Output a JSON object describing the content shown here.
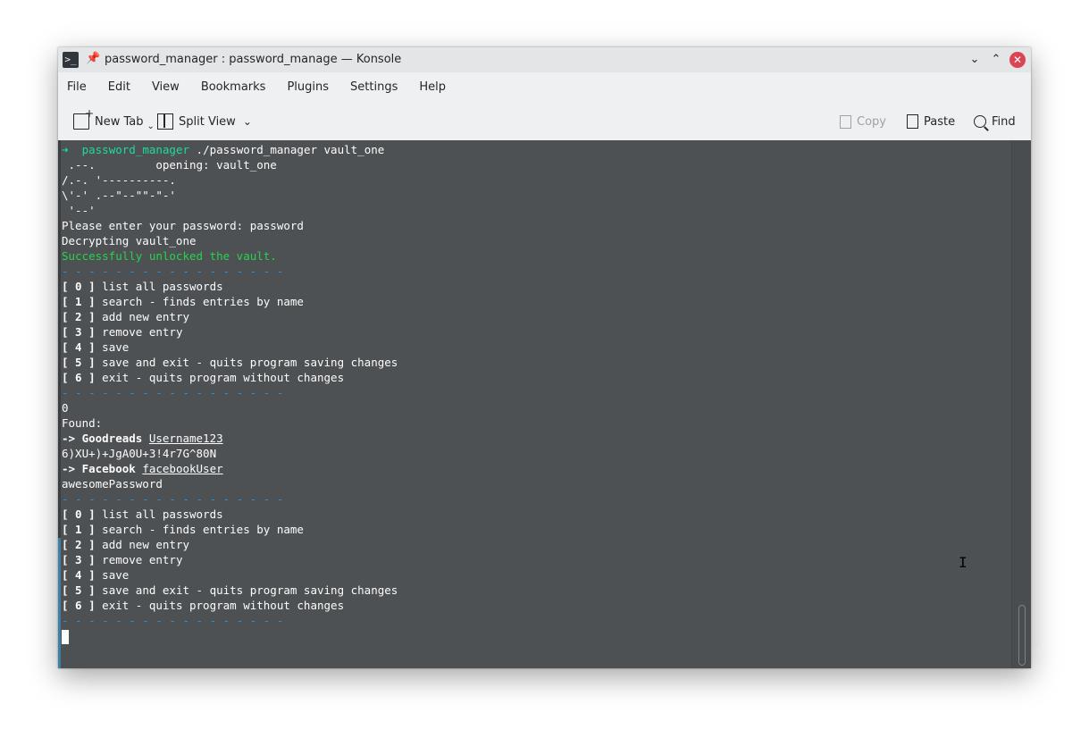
{
  "window": {
    "title": "password_manager : password_manage — Konsole"
  },
  "menubar": {
    "items": [
      "File",
      "Edit",
      "View",
      "Bookmarks",
      "Plugins",
      "Settings",
      "Help"
    ]
  },
  "toolbar": {
    "new_tab": "New Tab",
    "split_view": "Split View",
    "copy": "Copy",
    "paste": "Paste",
    "find": "Find"
  },
  "terminal": {
    "prompt_arrow": "➜",
    "prompt_dir": "password_manager",
    "command": "./password_manager vault_one",
    "art1": " .--.         opening: vault_one",
    "art2": "/.-. '----------.",
    "art3": "\\'-' .--\"--\"\"-\"-'",
    "art4": " '--'",
    "enter_password": "Please enter your password: password",
    "decrypting": "Decrypting vault_one",
    "unlocked": "Successfully unlocked the vault.",
    "separator": "- - - - - - - - - - - - - - - - -",
    "menu": [
      {
        "key": "[ 0 ]",
        "text": " list all passwords"
      },
      {
        "key": "[ 1 ]",
        "text": " search - finds entries by name"
      },
      {
        "key": "[ 2 ]",
        "text": " add new entry"
      },
      {
        "key": "[ 3 ]",
        "text": " remove entry"
      },
      {
        "key": "[ 4 ]",
        "text": " save"
      },
      {
        "key": "[ 5 ]",
        "text": " save and exit - quits program saving changes"
      },
      {
        "key": "[ 6 ]",
        "text": " exit - quits program without changes"
      }
    ],
    "input_choice": "0",
    "found": "Found:",
    "entries": [
      {
        "arrow": "-> ",
        "site": "Goodreads",
        "user": "Username123",
        "password": "6)XU+)+JgA0U+3!4r7G^80N"
      },
      {
        "arrow": "-> ",
        "site": "Facebook",
        "user": "facebookUser",
        "password": "awesomePassword"
      }
    ]
  }
}
